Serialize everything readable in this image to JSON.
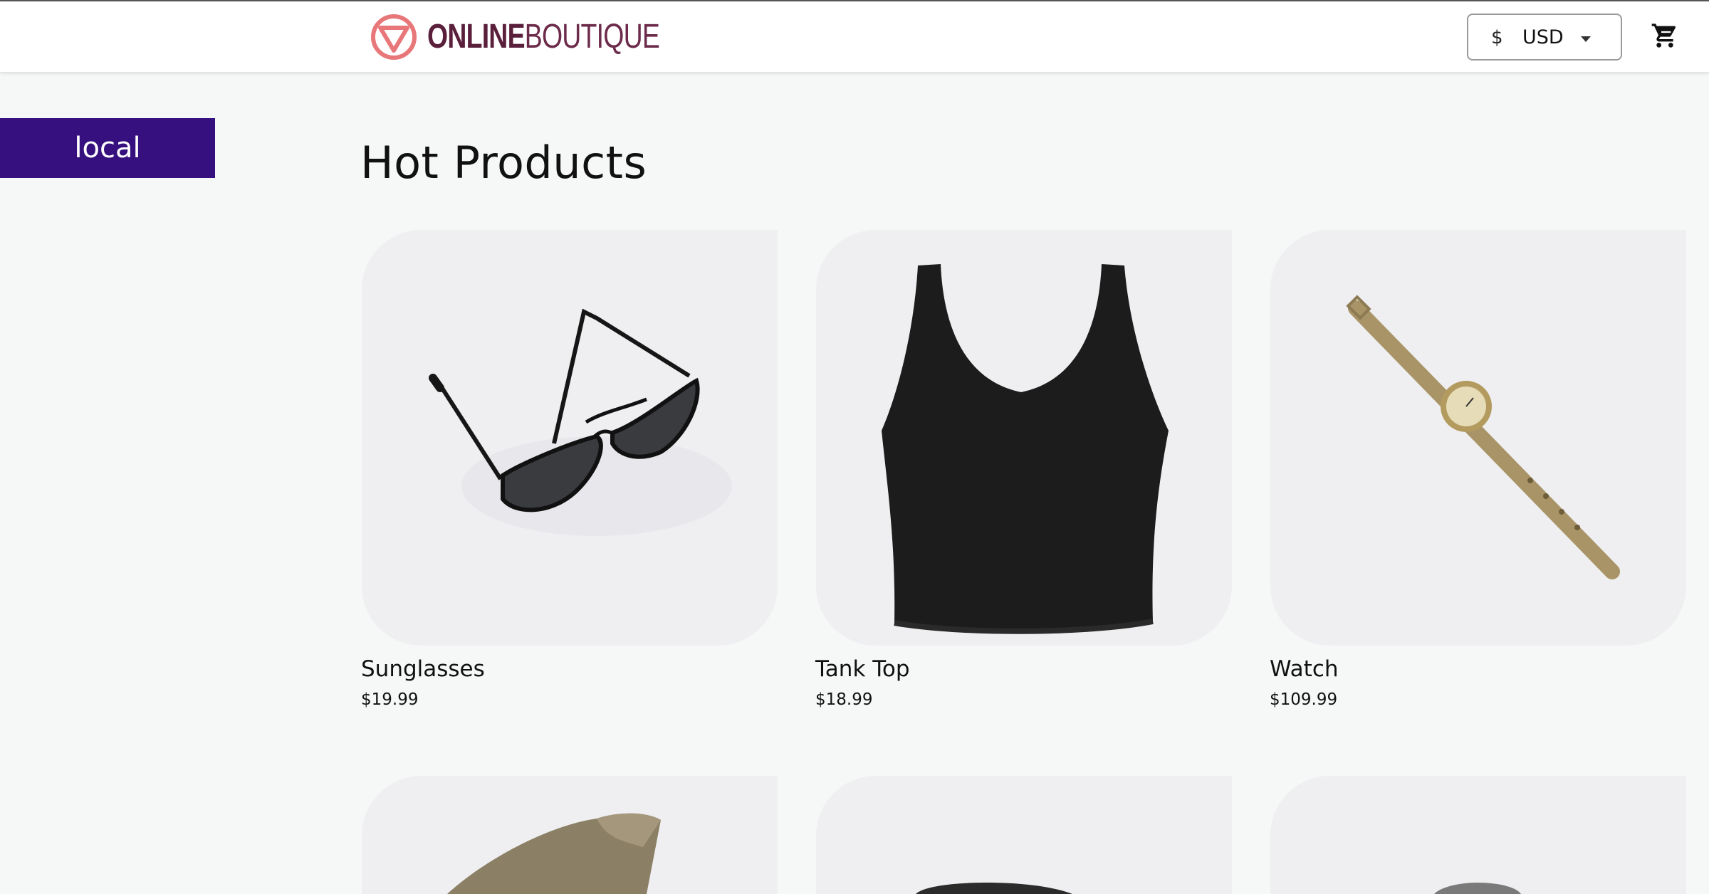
{
  "header": {
    "logo_bold": "ONLINE",
    "logo_light": "BOUTIQUE",
    "currency_symbol": "$",
    "currency_code": "USD",
    "cart_icon": "cart-icon",
    "logo_color": "#e8777a"
  },
  "environment_label": "local",
  "environment_color": "#35107e",
  "section_title": "Hot Products",
  "products": [
    {
      "name": "Sunglasses",
      "price": "$19.99",
      "icon": "sunglasses-image"
    },
    {
      "name": "Tank Top",
      "price": "$18.99",
      "icon": "tank-top-image"
    },
    {
      "name": "Watch",
      "price": "$109.99",
      "icon": "watch-image"
    }
  ],
  "next_row_images": [
    "loafers-image",
    "hairdryer-image",
    "candle-holder-image"
  ]
}
